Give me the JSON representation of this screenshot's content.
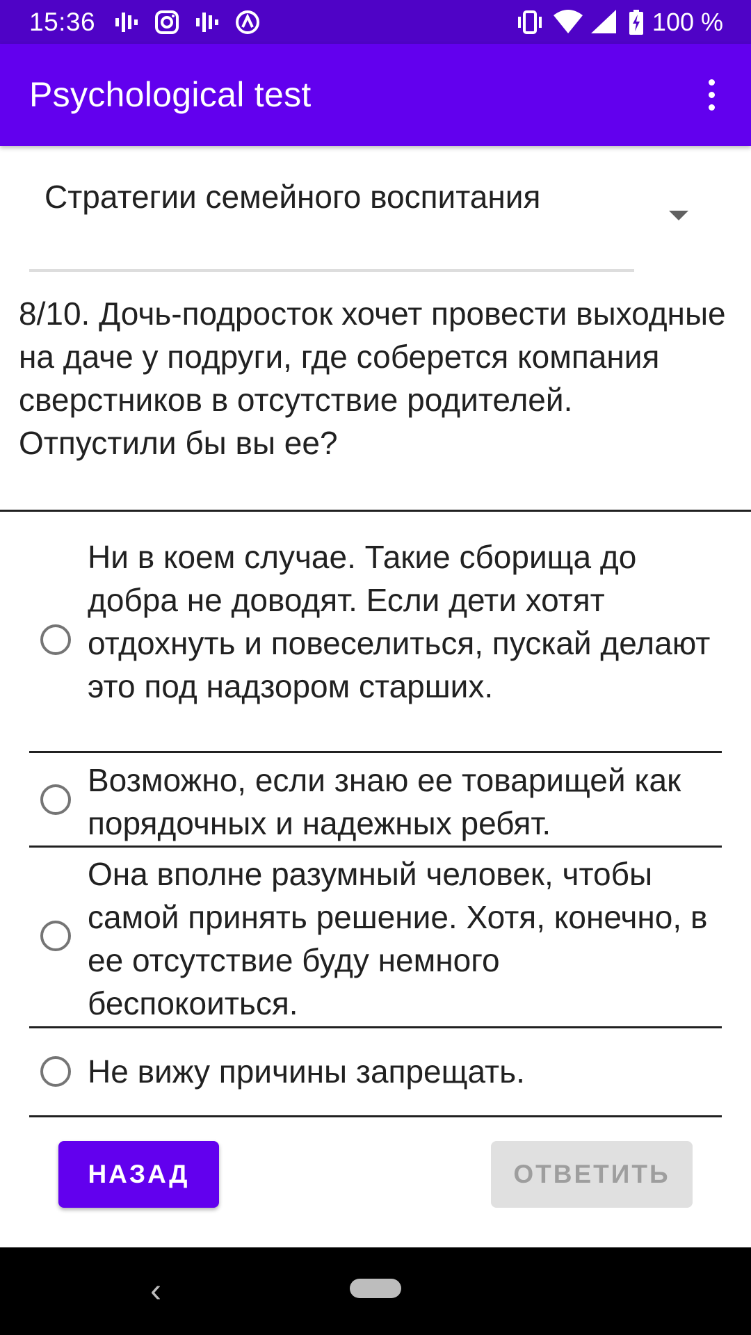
{
  "status_bar": {
    "time": "15:36",
    "battery": "100 %",
    "left_icons": [
      "signal-bars-icon",
      "instagram-icon",
      "signal-bars-icon",
      "circle-a-icon"
    ],
    "right_icons": [
      "vibrate-icon",
      "wifi-icon",
      "cell-signal-icon",
      "battery-charging-icon"
    ]
  },
  "app_bar": {
    "title": "Psychological test",
    "menu_icon": "more-vert-icon"
  },
  "spinner": {
    "selected": "Стратегии семейного воспитания"
  },
  "question": {
    "text": "8/10. Дочь-подросток хочет провести выходные на даче у подруги, где соберется компания сверстников в отсутствие родителей. Отпустили бы вы ее?"
  },
  "options": [
    {
      "label": "Ни в коем случае. Такие сборища до добра не доводят. Если дети хотят отдохнуть и повеселиться, пускай делают это под надзором старших.",
      "checked": false
    },
    {
      "label": "Возможно, если знаю ее товарищей как порядочных и надежных ребят.",
      "checked": false
    },
    {
      "label": "Она вполне разумный человек, чтобы самой принять решение. Хотя, конечно, в ее отсутствие буду немного беспокоиться.",
      "checked": false
    },
    {
      "label": "Не вижу причины запрещать.",
      "checked": false
    }
  ],
  "buttons": {
    "back": "НАЗАД",
    "answer": "ОТВЕТИТЬ"
  },
  "colors": {
    "status_bar": "#4F03C6",
    "primary": "#6200EE",
    "disabled_button": "#E0E0E0"
  }
}
